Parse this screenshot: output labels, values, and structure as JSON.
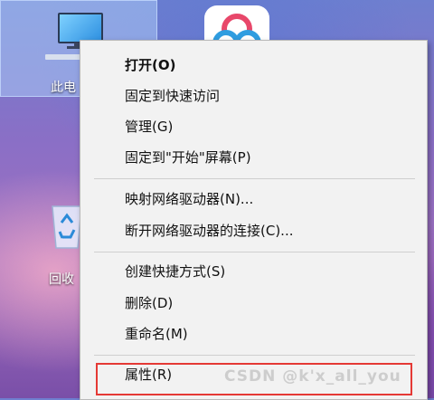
{
  "desktop": {
    "this_pc_label": "此电",
    "recycle_bin_label": "回收"
  },
  "context_menu": {
    "items": [
      {
        "label": "打开(O)",
        "bold": true
      },
      {
        "label": "固定到快速访问"
      },
      {
        "label": "管理(G)"
      },
      {
        "label": "固定到\"开始\"屏幕(P)"
      },
      {
        "label": "映射网络驱动器(N)..."
      },
      {
        "label": "断开网络驱动器的连接(C)..."
      },
      {
        "label": "创建快捷方式(S)"
      },
      {
        "label": "删除(D)"
      },
      {
        "label": "重命名(M)"
      },
      {
        "label": "属性(R)"
      }
    ]
  },
  "watermark": "CSDN @k'x_all_you",
  "colors": {
    "highlight": "#e53935",
    "menu_bg": "#f2f2f2"
  }
}
